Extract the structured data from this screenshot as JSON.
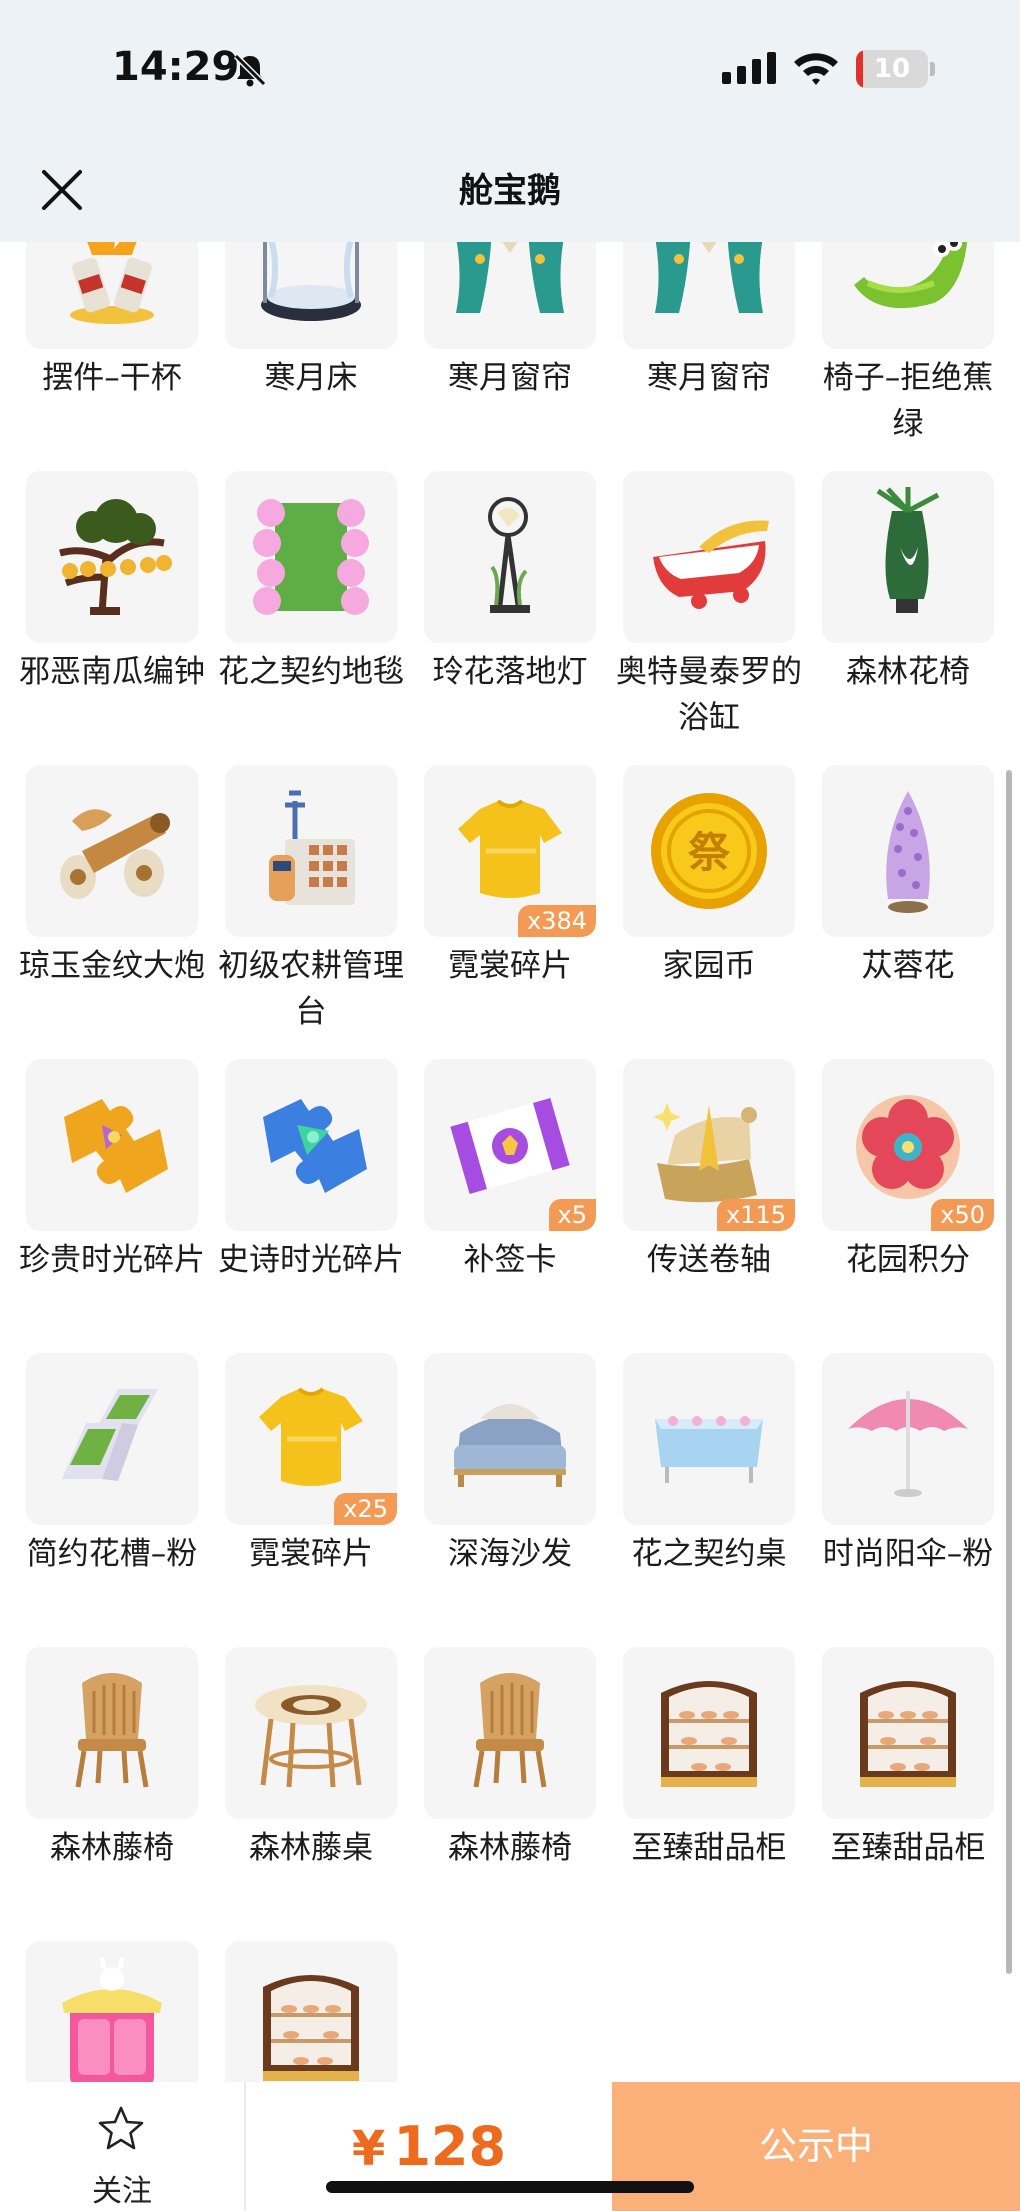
{
  "status_bar": {
    "time": "14:29",
    "battery": "10",
    "battery_level": 0.1
  },
  "nav": {
    "title": "舱宝鹅",
    "close_icon": "close-icon"
  },
  "accent_color": "#fbb07a",
  "price_color": "#ee6a1c",
  "items": [
    {
      "name": "摆件–干杯",
      "icon": "toast-ornament"
    },
    {
      "name": "寒月床",
      "icon": "round-bed"
    },
    {
      "name": "寒月窗帘",
      "icon": "curtain"
    },
    {
      "name": "寒月窗帘",
      "icon": "curtain"
    },
    {
      "name": "椅子–拒绝蕉绿",
      "icon": "banana-chair"
    },
    {
      "name": "邪恶南瓜编钟",
      "icon": "pumpkin-bells"
    },
    {
      "name": "花之契约地毯",
      "icon": "flower-rug"
    },
    {
      "name": "玲花落地灯",
      "icon": "floor-lamp"
    },
    {
      "name": "奥特曼泰罗的浴缸",
      "icon": "bathtub"
    },
    {
      "name": "森林花椅",
      "icon": "flower-chair"
    },
    {
      "name": "琼玉金纹大炮",
      "icon": "cannon"
    },
    {
      "name": "初级农耕管理台",
      "icon": "farm-console"
    },
    {
      "name": "霓裳碎片",
      "icon": "shirt-fragment",
      "qty": "x384"
    },
    {
      "name": "家园币",
      "icon": "coin"
    },
    {
      "name": "苁蓉花",
      "icon": "cistanche-flower"
    },
    {
      "name": "珍贵时光碎片",
      "icon": "gold-puzzle"
    },
    {
      "name": "史诗时光碎片",
      "icon": "blue-puzzle"
    },
    {
      "name": "补签卡",
      "icon": "ticket",
      "qty": "x5"
    },
    {
      "name": "传送卷轴",
      "icon": "scroll",
      "qty": "x115"
    },
    {
      "name": "花园积分",
      "icon": "flower-badge",
      "qty": "x50"
    },
    {
      "name": "简约花槽–粉",
      "icon": "planter"
    },
    {
      "name": "霓裳碎片",
      "icon": "shirt-fragment",
      "qty": "x25"
    },
    {
      "name": "深海沙发",
      "icon": "sofa"
    },
    {
      "name": "花之契约桌",
      "icon": "table-cloth"
    },
    {
      "name": "时尚阳伞–粉",
      "icon": "umbrella"
    },
    {
      "name": "森林藤椅",
      "icon": "rattan-chair"
    },
    {
      "name": "森林藤桌",
      "icon": "rattan-table"
    },
    {
      "name": "森林藤椅",
      "icon": "rattan-chair"
    },
    {
      "name": "至臻甜品柜",
      "icon": "dessert-cabinet"
    },
    {
      "name": "至臻甜品柜",
      "icon": "dessert-cabinet"
    },
    {
      "name": "",
      "icon": "pink-wardrobe"
    },
    {
      "name": "",
      "icon": "dessert-cabinet"
    }
  ],
  "bottom": {
    "follow_label": "关注",
    "currency": "¥",
    "price": "128",
    "action_label": "公示中"
  }
}
